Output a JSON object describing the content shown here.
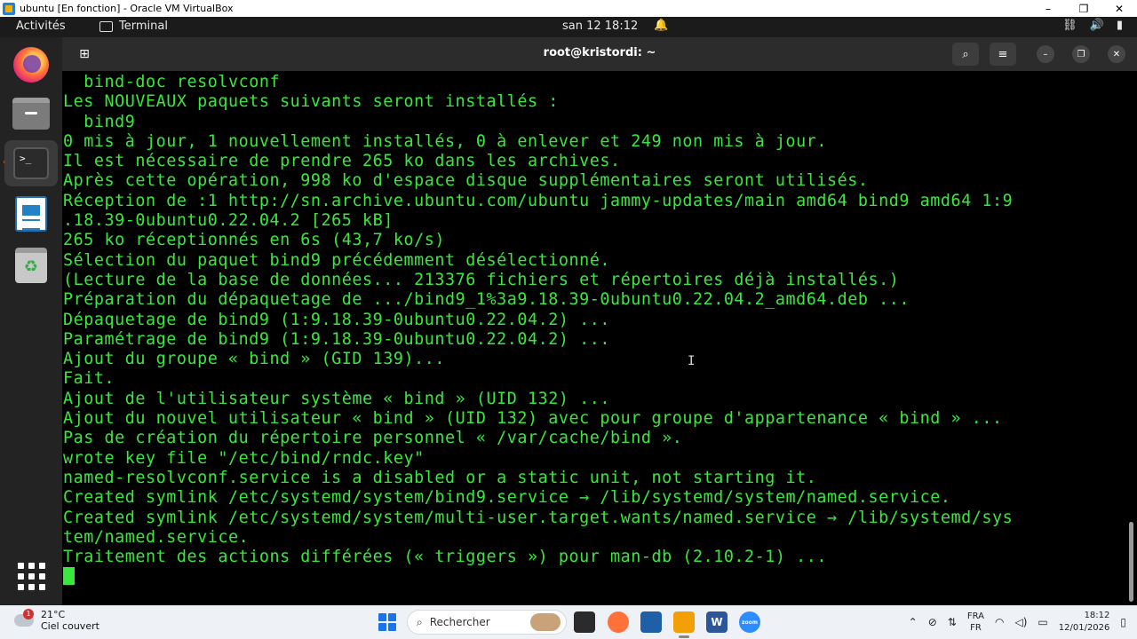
{
  "vbox": {
    "title": "ubuntu [En fonction] - Oracle VM VirtualBox",
    "minimize": "–",
    "restore": "❐",
    "close": "✕"
  },
  "topbar": {
    "activities": "Activités",
    "app_name": "Terminal",
    "clock": "san 12  18:12",
    "bell": "🔔",
    "network": "⛓",
    "volume": "🔊",
    "battery": "▮"
  },
  "dock": {
    "items": [
      "firefox-icon",
      "files-icon",
      "terminal-icon",
      "writer-icon",
      "trash-icon",
      "show-apps-icon"
    ],
    "terminal_glyph": ">_",
    "trash_glyph": "♻"
  },
  "terminal": {
    "title": "root@kristordi: ~",
    "new_tab_glyph": "⊞",
    "search_glyph": "⌕",
    "menu_glyph": "≡",
    "min_glyph": "–",
    "max_glyph": "❐",
    "close_glyph": "✕",
    "lines": [
      "  bind-doc resolvconf",
      "Les NOUVEAUX paquets suivants seront installés :",
      "  bind9",
      "0 mis à jour, 1 nouvellement installés, 0 à enlever et 249 non mis à jour.",
      "Il est nécessaire de prendre 265 ko dans les archives.",
      "Après cette opération, 998 ko d'espace disque supplémentaires seront utilisés.",
      "Réception de :1 http://sn.archive.ubuntu.com/ubuntu jammy-updates/main amd64 bind9 amd64 1:9",
      ".18.39-0ubuntu0.22.04.2 [265 kB]",
      "265 ko réceptionnés en 6s (43,7 ko/s)",
      "Sélection du paquet bind9 précédemment désélectionné.",
      "(Lecture de la base de données... 213376 fichiers et répertoires déjà installés.)",
      "Préparation du dépaquetage de .../bind9_1%3a9.18.39-0ubuntu0.22.04.2_amd64.deb ...",
      "Dépaquetage de bind9 (1:9.18.39-0ubuntu0.22.04.2) ...",
      "Paramétrage de bind9 (1:9.18.39-0ubuntu0.22.04.2) ...",
      "Ajout du groupe « bind » (GID 139)...",
      "Fait.",
      "Ajout de l'utilisateur système « bind » (UID 132) ...",
      "Ajout du nouvel utilisateur « bind » (UID 132) avec pour groupe d'appartenance « bind » ...",
      "Pas de création du répertoire personnel « /var/cache/bind ».",
      "wrote key file \"/etc/bind/rndc.key\"",
      "named-resolvconf.service is a disabled or a static unit, not starting it.",
      "Created symlink /etc/systemd/system/bind9.service → /lib/systemd/system/named.service.",
      "Created symlink /etc/systemd/system/multi-user.target.wants/named.service → /lib/systemd/sys",
      "tem/named.service.",
      "Traitement des actions différées (« triggers ») pour man-db (2.10.2-1) ..."
    ],
    "text_color": "#39e83c"
  },
  "taskbar": {
    "weather_badge": "1",
    "temperature": "21°C",
    "weather": "Ciel couvert",
    "search_placeholder": "Rechercher",
    "apps": [
      "file-explorer",
      "firefox",
      "virtualbox",
      "sublime-text",
      "word",
      "zoom"
    ],
    "word_glyph": "W",
    "zoom_glyph": "zoom",
    "lang_top": "FRA",
    "lang_bottom": "FR",
    "time": "18:12",
    "date": "12/01/2026"
  }
}
